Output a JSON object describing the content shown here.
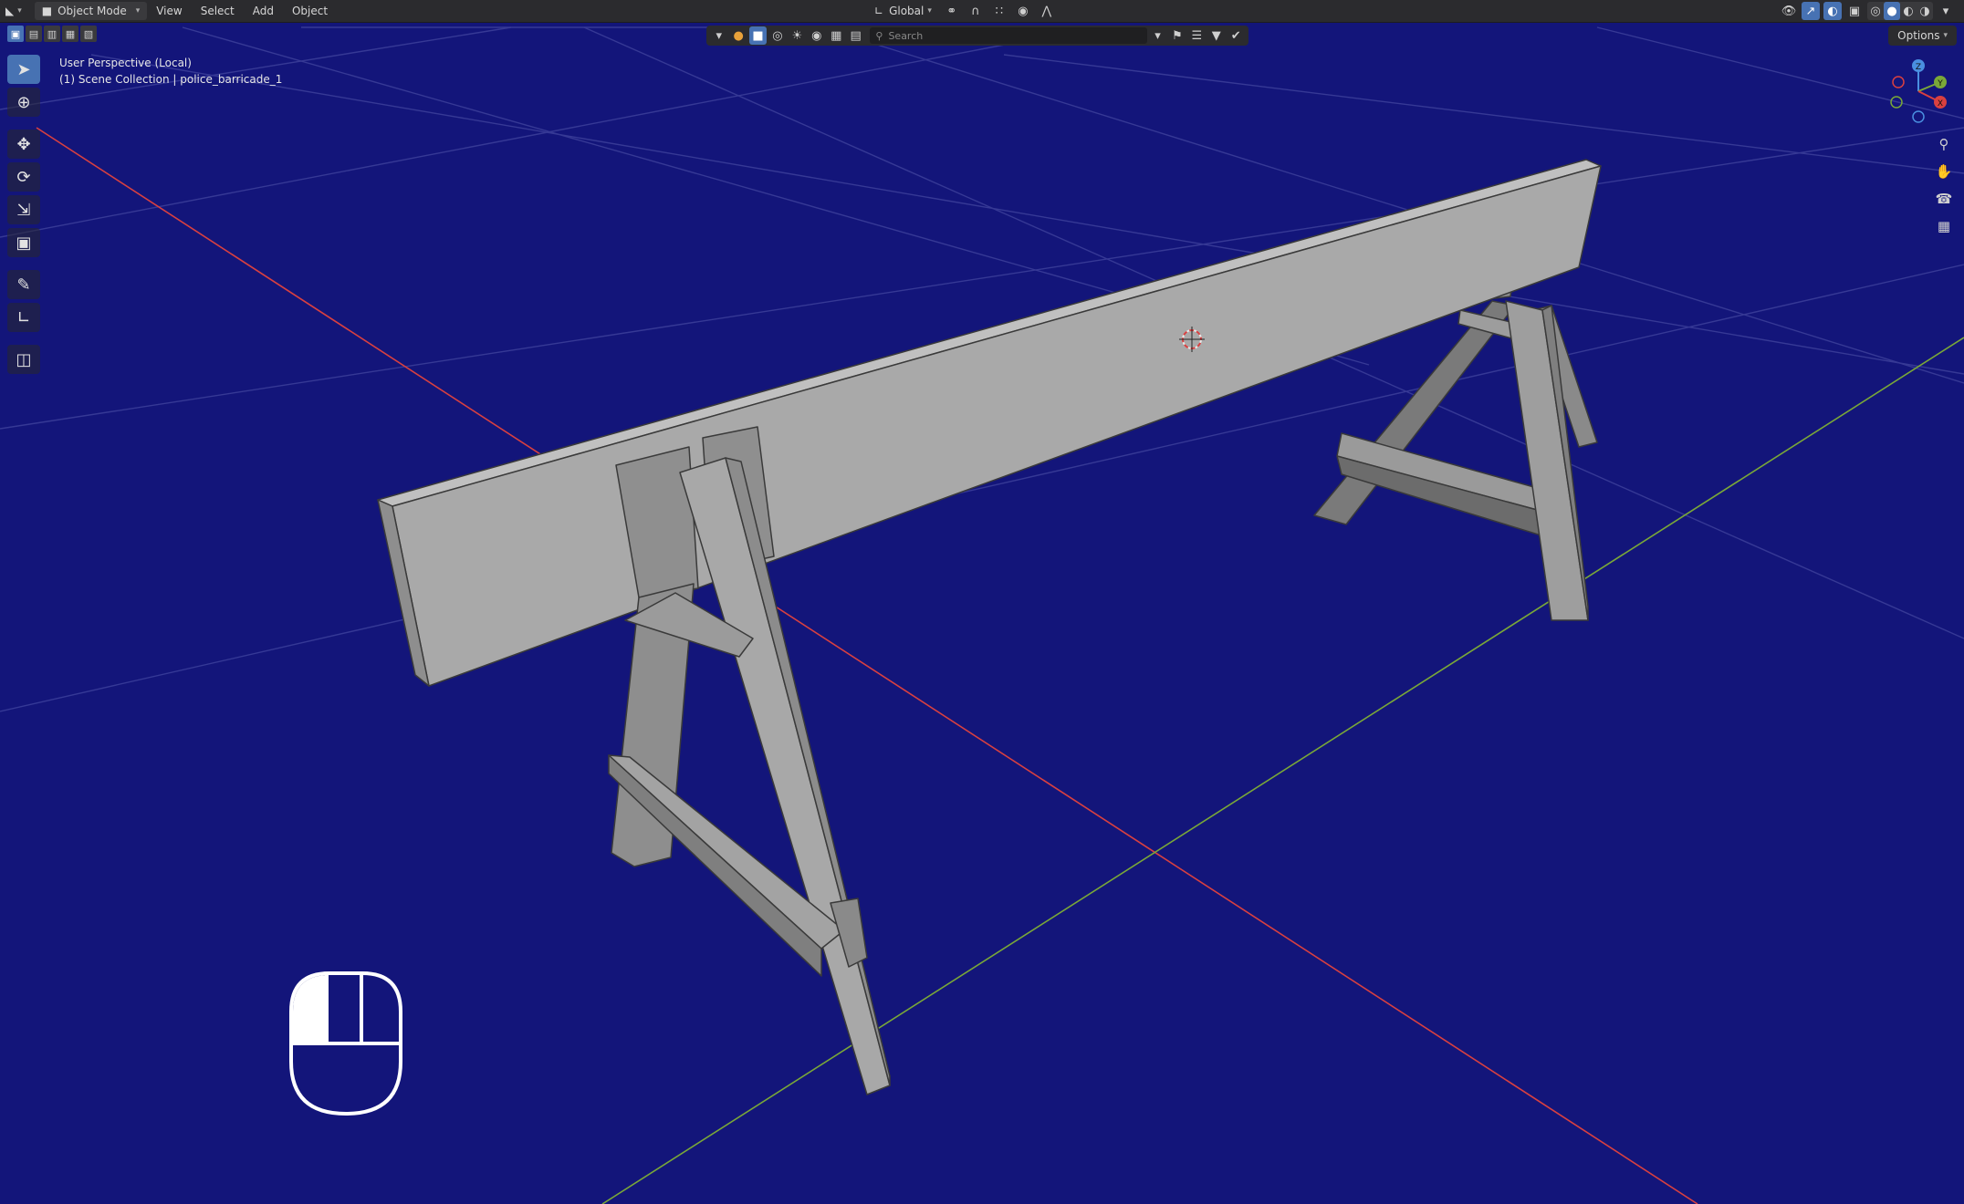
{
  "header": {
    "mode_label": "Object Mode",
    "menus": [
      "View",
      "Select",
      "Add",
      "Object"
    ],
    "transform_orientation": "Global"
  },
  "toolbar2": {
    "search_placeholder": "Search",
    "options_label": "Options"
  },
  "viewport": {
    "perspective_label": "User Perspective (Local)",
    "collection_label": "(1) Scene Collection | police_barricade_1",
    "background_color": "#13157a",
    "x_axis_color": "#d94040",
    "y_axis_color": "#7aa838"
  },
  "gizmo": {
    "z_label": "Z",
    "y_label": "Y",
    "x_label": "X"
  },
  "icons": {
    "editor_type": "viewport-editor-icon",
    "select_modes": [
      "select-new-icon",
      "select-extend-icon",
      "select-subtract-icon",
      "select-intersect-icon"
    ],
    "tools": [
      "select-box-icon",
      "cursor-icon",
      "move-icon",
      "rotate-icon",
      "scale-icon",
      "transform-icon",
      "annotate-icon",
      "measure-icon",
      "add-cube-icon"
    ],
    "nav": [
      "zoom-icon",
      "pan-hand-icon",
      "camera-icon",
      "grid-ortho-icon"
    ]
  }
}
